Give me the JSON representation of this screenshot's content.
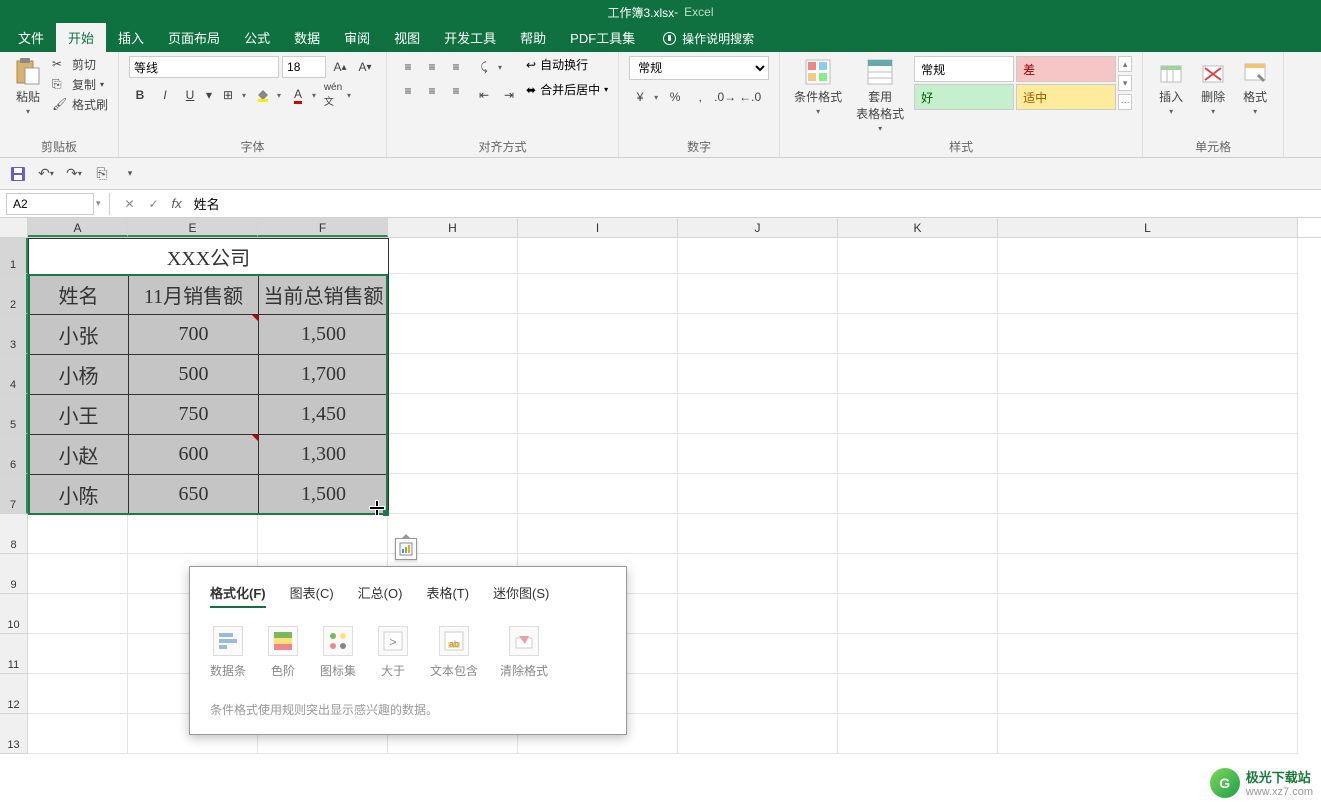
{
  "title": {
    "doc": "工作簿3.xlsx",
    "sep": " - ",
    "app": "Excel"
  },
  "menu": {
    "file": "文件",
    "home": "开始",
    "insert": "插入",
    "page": "页面布局",
    "formulas": "公式",
    "data": "数据",
    "review": "审阅",
    "view": "视图",
    "dev": "开发工具",
    "help": "帮助",
    "pdf": "PDF工具集",
    "tellme": "操作说明搜索"
  },
  "ribbon": {
    "clipboard": {
      "paste": "粘贴",
      "cut": "剪切",
      "copy": "复制",
      "painter": "格式刷",
      "label": "剪贴板"
    },
    "font": {
      "name": "等线",
      "size": "18",
      "label": "字体"
    },
    "align": {
      "wrap": "自动换行",
      "merge": "合并后居中",
      "label": "对齐方式"
    },
    "number": {
      "format": "常规",
      "label": "数字"
    },
    "styles": {
      "cond": "条件格式",
      "table": "套用\n表格格式",
      "normal": "常规",
      "bad": "差",
      "good": "好",
      "neutral": "适中",
      "label": "样式"
    },
    "cells": {
      "insert": "插入",
      "delete": "删除",
      "format": "格式",
      "label": "单元格"
    }
  },
  "formula_bar": {
    "namebox": "A2",
    "value": "姓名"
  },
  "columns": {
    "A": "A",
    "E": "E",
    "F": "F",
    "H": "H",
    "I": "I",
    "J": "J",
    "K": "K",
    "L": "L"
  },
  "row_numbers": [
    "1",
    "2",
    "3",
    "4",
    "5",
    "6",
    "7",
    "8",
    "9",
    "10",
    "11",
    "12",
    "13"
  ],
  "sheet": {
    "title": "XXX公司",
    "headers": {
      "name": "姓名",
      "nov": "11月销售额",
      "total": "当前总销售额"
    },
    "rows": [
      {
        "name": "小张",
        "nov": "700",
        "total": "1,500"
      },
      {
        "name": "小杨",
        "nov": "500",
        "total": "1,700"
      },
      {
        "name": "小王",
        "nov": "750",
        "total": "1,450"
      },
      {
        "name": "小赵",
        "nov": "600",
        "total": "1,300"
      },
      {
        "name": "小陈",
        "nov": "650",
        "total": "1,500"
      }
    ]
  },
  "quick": {
    "tabs": {
      "format": "格式化(F)",
      "chart": "图表(C)",
      "summary": "汇总(O)",
      "table": "表格(T)",
      "spark": "迷你图(S)"
    },
    "opts": {
      "databar": "数据条",
      "colorscale": "色阶",
      "iconset": "图标集",
      "greater": "大于",
      "textcontains": "文本包含",
      "clear": "清除格式"
    },
    "desc": "条件格式使用规则突出显示感兴趣的数据。"
  },
  "watermark": {
    "brand": "极光下载站",
    "url": "www.xz7.com"
  }
}
